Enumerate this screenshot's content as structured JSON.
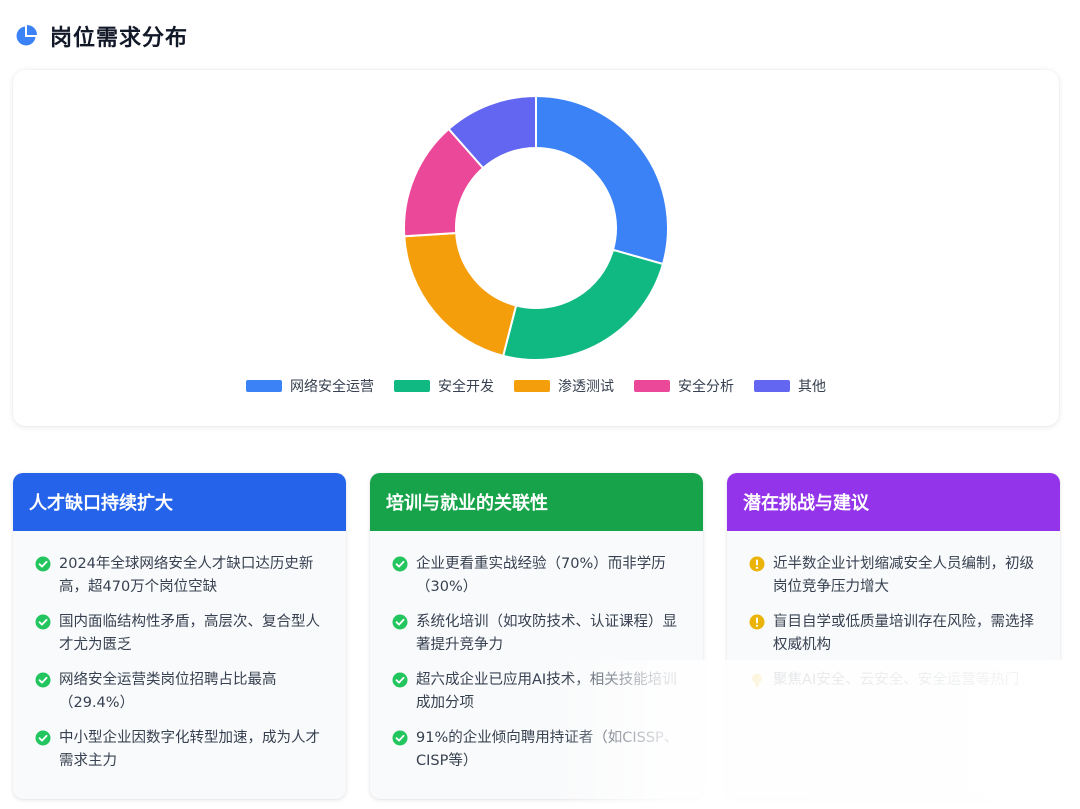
{
  "section": {
    "title": "岗位需求分布",
    "icon": "pie-chart-icon",
    "icon_color": "#3b82f6"
  },
  "chart_data": {
    "type": "pie",
    "categories": [
      "网络安全运营",
      "安全开发",
      "渗透测试",
      "安全分析",
      "其他"
    ],
    "values": [
      29.4,
      24.6,
      20.0,
      14.5,
      11.5
    ],
    "colors": [
      "#3b82f6",
      "#10b981",
      "#f59e0b",
      "#ec4899",
      "#6366f1"
    ],
    "donut": true,
    "legend_position": "bottom",
    "title": ""
  },
  "cards": [
    {
      "title": "人才缺口持续扩大",
      "color": "#2563eb",
      "items": [
        "2024年全球网络安全人才缺口达历史新高，超470万个岗位空缺",
        "国内面临结构性矛盾，高层次、复合型人才尤为匮乏",
        "网络安全运营类岗位招聘占比最高（29.4%）",
        "中小型企业因数字化转型加速，成为人才需求主力"
      ]
    },
    {
      "title": "培训与就业的关联性",
      "color": "#16a34a",
      "items": [
        "企业更看重实战经验（70%）而非学历（30%）",
        "系统化培训（如攻防技术、认证课程）显著提升竞争力",
        "超六成企业已应用AI技术，相关技能培训成加分项",
        "91%的企业倾向聘用持证者（如CISSP、CISP等）"
      ]
    },
    {
      "title": "潜在挑战与建议",
      "color": "#9333ea",
      "items": [
        "近半数企业计划缩减安全人员编制，初级岗位竞争压力增大",
        "盲目自学或低质量培训存在风险，需选择权威机构",
        "聚焦AI安全、云安全、安全运营等热门"
      ]
    }
  ],
  "icons": {
    "check": "check-circle-icon",
    "warning": "exclamation-circle-icon",
    "tip": "lightbulb-icon",
    "check_color": "#22c55e",
    "warning_color": "#eab308"
  }
}
